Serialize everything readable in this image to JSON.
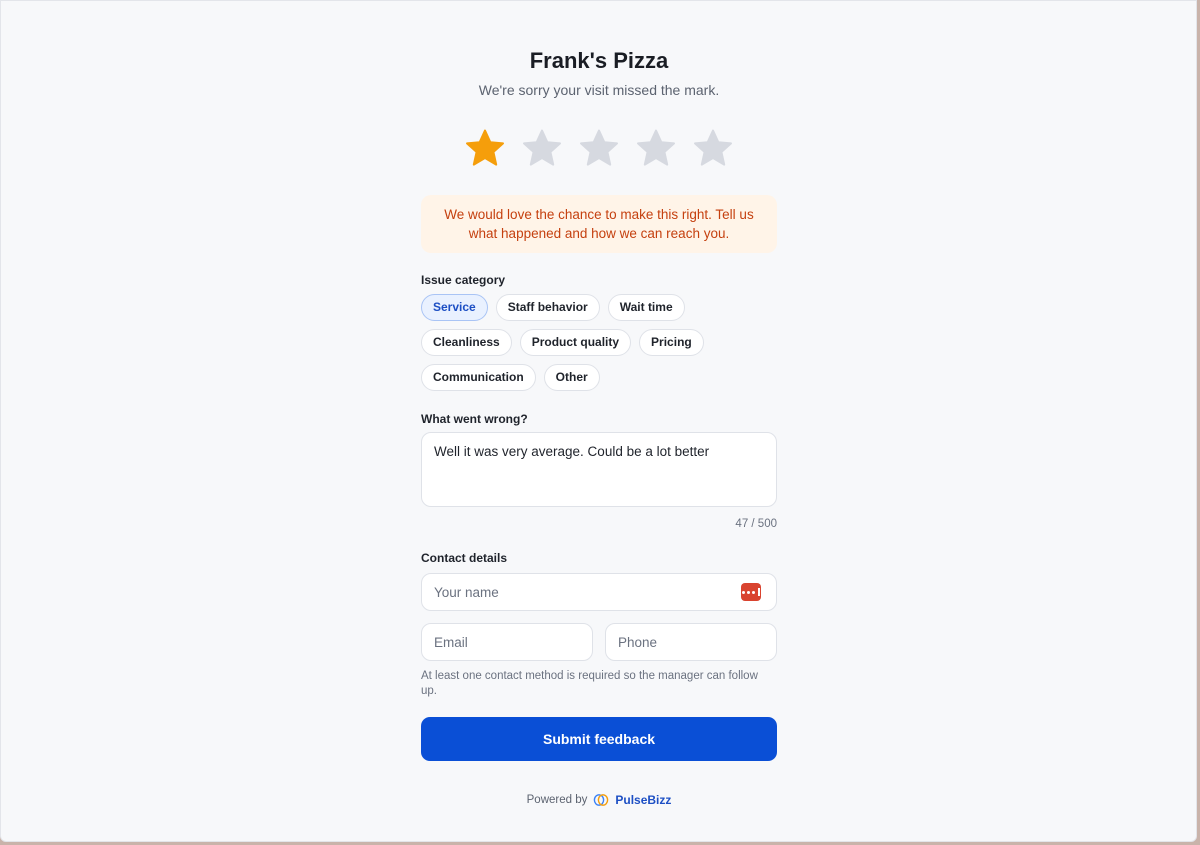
{
  "header": {
    "title": "Frank's Pizza",
    "subtitle": "We're sorry your visit missed the mark."
  },
  "rating": {
    "value": 1,
    "max": 5,
    "filled_color": "#f59e0b",
    "empty_color": "#d6d9e0"
  },
  "notice": {
    "text": "We would love the chance to make this right. Tell us what happened and how we can reach you."
  },
  "issue_category": {
    "label": "Issue category",
    "selected": "Service",
    "options": [
      "Service",
      "Staff behavior",
      "Wait time",
      "Cleanliness",
      "Product quality",
      "Pricing",
      "Communication",
      "Other"
    ]
  },
  "what_went_wrong": {
    "label": "What went wrong?",
    "value": "Well it was very average. Could be a lot better",
    "counter": "47 / 500"
  },
  "contact": {
    "label": "Contact details",
    "name_placeholder": "Your name",
    "name_icon": "password-manager-icon",
    "email_placeholder": "Email",
    "phone_placeholder": "Phone",
    "hint": "At least one contact method is required so the manager can follow up."
  },
  "submit": {
    "label": "Submit feedback",
    "color": "#0a4fd6"
  },
  "footer": {
    "powered_by": "Powered by",
    "brand_icon": "pulsebizz-logo-icon",
    "brand": "PulseBizz"
  }
}
